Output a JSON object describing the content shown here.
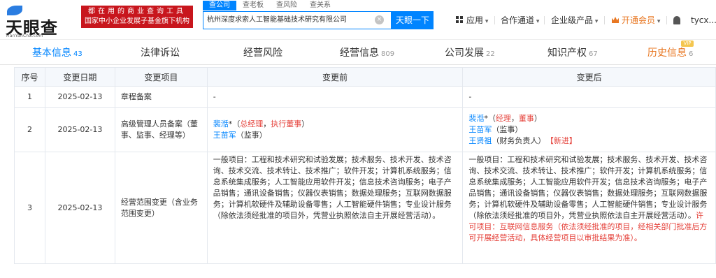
{
  "header": {
    "brand": "天眼查",
    "domain": "TianYanCha.com",
    "promo_line1": "都在用的商业查询工具",
    "promo_line2": "国家中小企业发展子基金旗下机构",
    "search_tabs": [
      "查公司",
      "查老板",
      "查风险",
      "查关系"
    ],
    "search_value": "杭州深度求索人工智能基础技术研究有限公司",
    "search_button": "天眼一下",
    "nav": {
      "app": "应用",
      "cooperation": "合作通道",
      "enterprise": "企业级产品",
      "vip": "开通会员",
      "user": "tycx..."
    }
  },
  "tabs": [
    {
      "label": "基本信息",
      "count": "43"
    },
    {
      "label": "法律诉讼",
      "count": ""
    },
    {
      "label": "经营风险",
      "count": ""
    },
    {
      "label": "经营信息",
      "count": "809"
    },
    {
      "label": "公司发展",
      "count": "22"
    },
    {
      "label": "知识产权",
      "count": "67"
    },
    {
      "label": "历史信息",
      "count": "6"
    }
  ],
  "vip_badge": "VIP",
  "table": {
    "headers": [
      "序号",
      "变更日期",
      "变更项目",
      "变更前",
      "变更后"
    ],
    "rows": [
      {
        "index": "1",
        "date": "2025-02-13",
        "item": "章程备案",
        "before": "-",
        "after": "-"
      },
      {
        "index": "2",
        "date": "2025-02-13",
        "item": "高级管理人员备案（董事、监事、经理等）",
        "before": {
          "p1_name": "裴湉",
          "p1_mark": "*",
          "p1_open": "（",
          "p1_role1": "总经理",
          "p1_sep": "，",
          "p1_role2": "执行董事",
          "p1_close": "）",
          "p2_name": "王苗军",
          "p2_role": "（监事）"
        },
        "after": {
          "p1_name": "裴湉",
          "p1_mark": "*",
          "p1_open": "（",
          "p1_role1": "经理",
          "p1_sep": "，",
          "p1_role2": "董事",
          "p1_close": "）",
          "p2_name": "王苗军",
          "p2_role": "（监事）",
          "p3_name": "王贤祖",
          "p3_role": "（财务负责人）",
          "p3_tag": "【新进】"
        }
      },
      {
        "index": "3",
        "date": "2025-02-13",
        "item": "经营范围变更（含业务范围变更）",
        "before": "一般项目：工程和技术研究和试验发展；技术服务、技术开发、技术咨询、技术交流、技术转让、技术推广；软件开发；计算机系统服务；信息系统集成服务；人工智能应用软件开发；信息技术咨询服务；电子产品销售；通讯设备销售；仪器仪表销售；数据处理服务；互联网数据服务；计算机软硬件及辅助设备零售；人工智能硬件销售；专业设计服务（除依法须经批准的项目外，凭营业执照依法自主开展经营活动）。",
        "after_normal": "一般项目：工程和技术研究和试验发展；技术服务、技术开发、技术咨询、技术交流、技术转让、技术推广；软件开发；计算机系统服务；信息系统集成服务；人工智能应用软件开发；信息技术咨询服务；电子产品销售；通讯设备销售；仪器仪表销售；数据处理服务；互联网数据服务；计算机软硬件及辅助设备零售；人工智能硬件销售；专业设计服务（除依法须经批准的项目外，凭营业执照依法自主开展经营活动）。",
        "after_highlight": "许可项目：互联网信息服务（依法须经批准的项目，经相关部门批准后方可开展经营活动，具体经营项目以审批结果为准）。"
      }
    ]
  },
  "colors": {
    "accent": "#0084ff",
    "promo_red": "#c8161d",
    "change_red": "#e5423b",
    "vip_orange": "#e87722"
  }
}
